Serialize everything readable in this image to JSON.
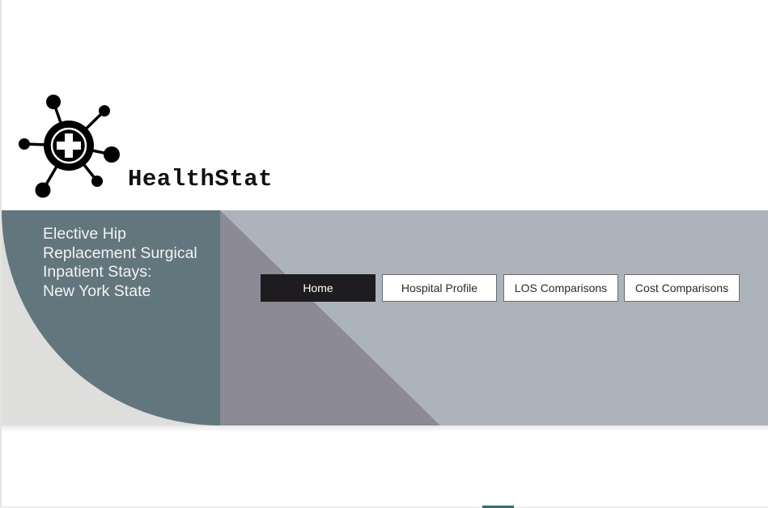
{
  "brand": {
    "name": "HealthStat",
    "logo_icon": "network-medical-cross-icon"
  },
  "banner": {
    "title_lines": [
      "Elective Hip",
      "Replacement Surgical",
      "Inpatient Stays:",
      "New York State"
    ]
  },
  "nav": {
    "items": [
      {
        "label": "Home",
        "active": true
      },
      {
        "label": "Hospital Profile",
        "active": false
      },
      {
        "label": "LOS Comparisons",
        "active": false
      },
      {
        "label": "Cost Comparisons",
        "active": false
      }
    ]
  },
  "colors": {
    "banner_bg": "#adb3ba",
    "banner_dark": "#62767d",
    "banner_light": "#dededc",
    "triangle": "#8b8a95",
    "active_nav": "#1e1c1e"
  }
}
